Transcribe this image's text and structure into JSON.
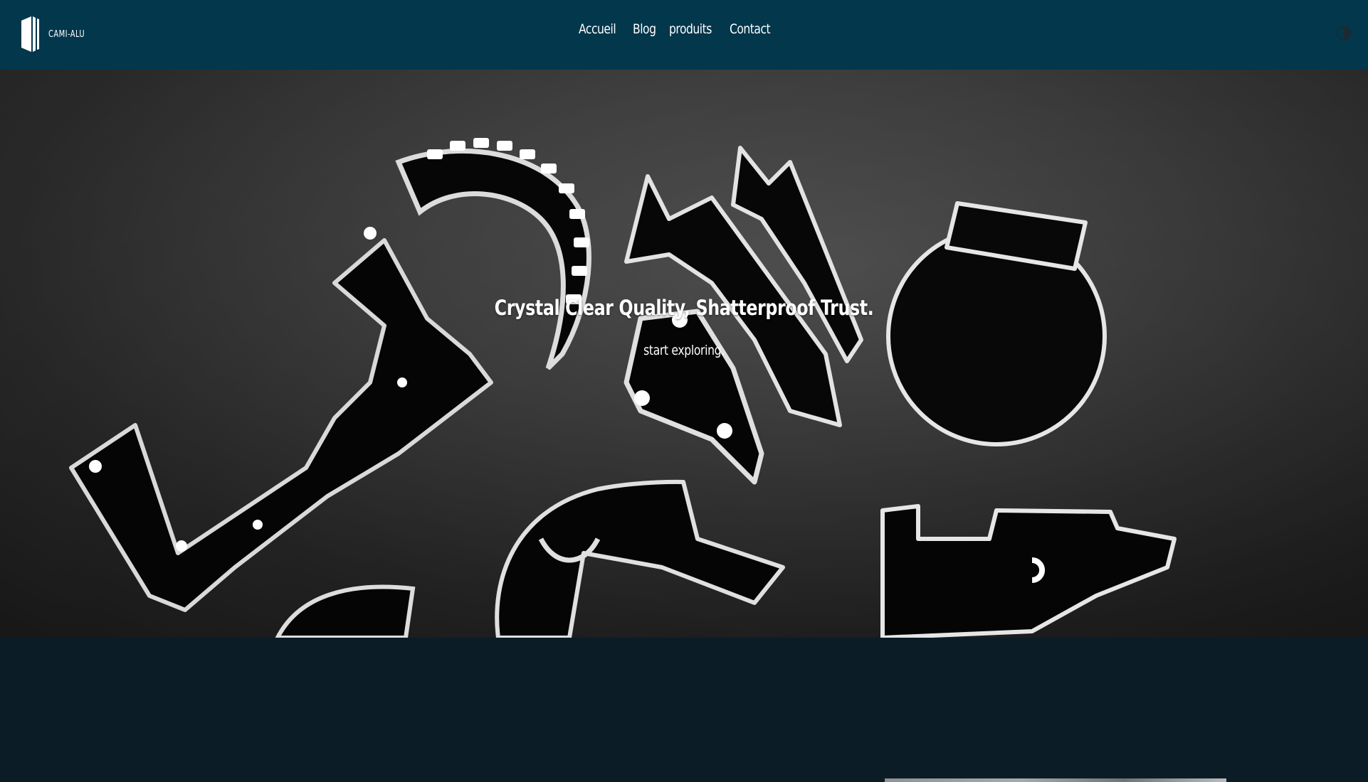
{
  "brand": {
    "logo_text": "CAMI-ALU"
  },
  "nav": {
    "items": [
      {
        "label": "Accueil"
      },
      {
        "label": "Blog"
      },
      {
        "label": "produits"
      },
      {
        "label": "Contact"
      }
    ]
  },
  "theme_toggle": {
    "icon": "half-circle-contrast-icon"
  },
  "hero": {
    "title": "Crystal Clear Quality, Shatterproof Trust.",
    "subtitle": "start exploring."
  },
  "colors": {
    "header_bg": "#03374c",
    "page_bg": "#0b1c26",
    "text": "#ffffff"
  }
}
